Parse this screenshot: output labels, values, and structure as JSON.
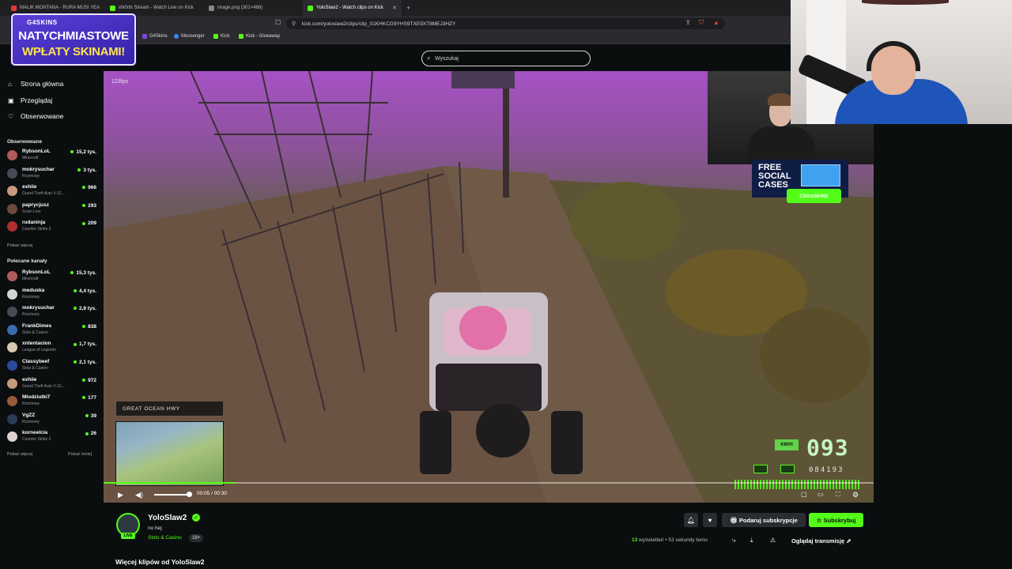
{
  "browser": {
    "tabs": [
      {
        "label": "MALIK MONTANA - RURA MUSI YEA",
        "color": "#e53935"
      },
      {
        "label": "xN0rth Stream - Watch Live on Kick",
        "color": "#53fc18"
      },
      {
        "label": "image.png (301×468)",
        "color": "#888888"
      },
      {
        "label": "YoloSlaw2 - Watch clips on Kick",
        "color": "#53fc18"
      }
    ],
    "url": "kick.com/yoloslaw2/clips/clip_01KHKCG9YHS9TXE9XT8MEJ3HZY",
    "bookmarks": [
      "G4Skins",
      "Messenger",
      "Kick",
      "Kick - Giveaway"
    ]
  },
  "promo": {
    "brand": "G4SKINS",
    "line1": "NATYCHMIASTOWE",
    "line2": "WPŁATY SKINAMI!"
  },
  "search": {
    "placeholder": "Wyszukaj"
  },
  "nav": {
    "home": "Strona główna",
    "browse": "Przeglądaj",
    "following": "Obserwowane"
  },
  "followed": {
    "title": "Obserwowane",
    "items": [
      {
        "name": "RybsonLoL",
        "category": "Minecraft",
        "viewers": "15,2 tys.",
        "color": "#b05a5a"
      },
      {
        "name": "mokrysuchar",
        "category": "Rozmowy",
        "viewers": "3 tys.",
        "color": "#444b55"
      },
      {
        "name": "exhiie",
        "category": "Grand Theft Auto V (G...",
        "viewers": "966",
        "color": "#c79a7d"
      },
      {
        "name": "paprycjusz",
        "category": "Scam Line",
        "viewers": "293",
        "color": "#6b4a3a"
      },
      {
        "name": "rudaninja",
        "category": "Counter-Strike 2",
        "viewers": "209",
        "color": "#b03030"
      }
    ],
    "more": "Pokaż więcej"
  },
  "recommended": {
    "title": "Polecane kanały",
    "items": [
      {
        "name": "RybsonLoL",
        "category": "Minecraft",
        "viewers": "15,3 tys.",
        "color": "#b05a5a"
      },
      {
        "name": "meduska",
        "category": "Rozmowy",
        "viewers": "4,4 tys.",
        "color": "#d4d4d4"
      },
      {
        "name": "mokrysuchar",
        "category": "Rozmowy",
        "viewers": "2,8 tys.",
        "color": "#444b55"
      },
      {
        "name": "FrankDimes",
        "category": "Slots & Casino",
        "viewers": "838",
        "color": "#3a6ab0"
      },
      {
        "name": "xntentacion",
        "category": "League of Legends",
        "viewers": "1,7 tys.",
        "color": "#d8c8b0"
      },
      {
        "name": "Classybeef",
        "category": "Slots & Casino",
        "viewers": "2,1 tys.",
        "color": "#2a4a9a"
      },
      {
        "name": "exhiie",
        "category": "Grand Theft Auto V (G...",
        "viewers": "972",
        "color": "#c79a7d"
      },
      {
        "name": "Mlodziutki7",
        "category": "Rozmowy",
        "viewers": "177",
        "color": "#9a5a3a"
      },
      {
        "name": "VgZZ",
        "category": "Rozmowy",
        "viewers": "39",
        "color": "#2b3a55"
      },
      {
        "name": "korneelcia",
        "category": "Counter-Strike 2",
        "viewers": "26",
        "color": "#e0d0d0"
      }
    ],
    "more": "Pokaż więcej",
    "less": "Pokaż mniej"
  },
  "video": {
    "fps": "123fps",
    "street": "GREAT OCEAN HWY",
    "speed_unit": "KM/H",
    "speed": "093",
    "odometer": "084193",
    "current_time": "00:05",
    "duration": "00:30",
    "progress": 0.17,
    "volume": 0.9
  },
  "overlay": {
    "free_line1": "FREE",
    "free_line2": "SOCIAL",
    "free_line3": "CASES",
    "sponsor": "CSG⊙SKINS"
  },
  "channel": {
    "name": "YoloSlaw2",
    "title": "no hej",
    "category": "Slots & Casino",
    "age": "18+",
    "live": "LIVE"
  },
  "actions": {
    "gift": "Podaruj subskrypcje",
    "subscribe": "Subskrybuj",
    "watch": "Oglądaj transmisję"
  },
  "meta": {
    "views_count": "13",
    "views_label": "wyświetleń",
    "age": "• 53 sekundy temu"
  },
  "more_clips": "Więcej klipów od YoloSlaw2",
  "colors": {
    "accent": "#53fc18",
    "bg": "#0b0e0f"
  }
}
